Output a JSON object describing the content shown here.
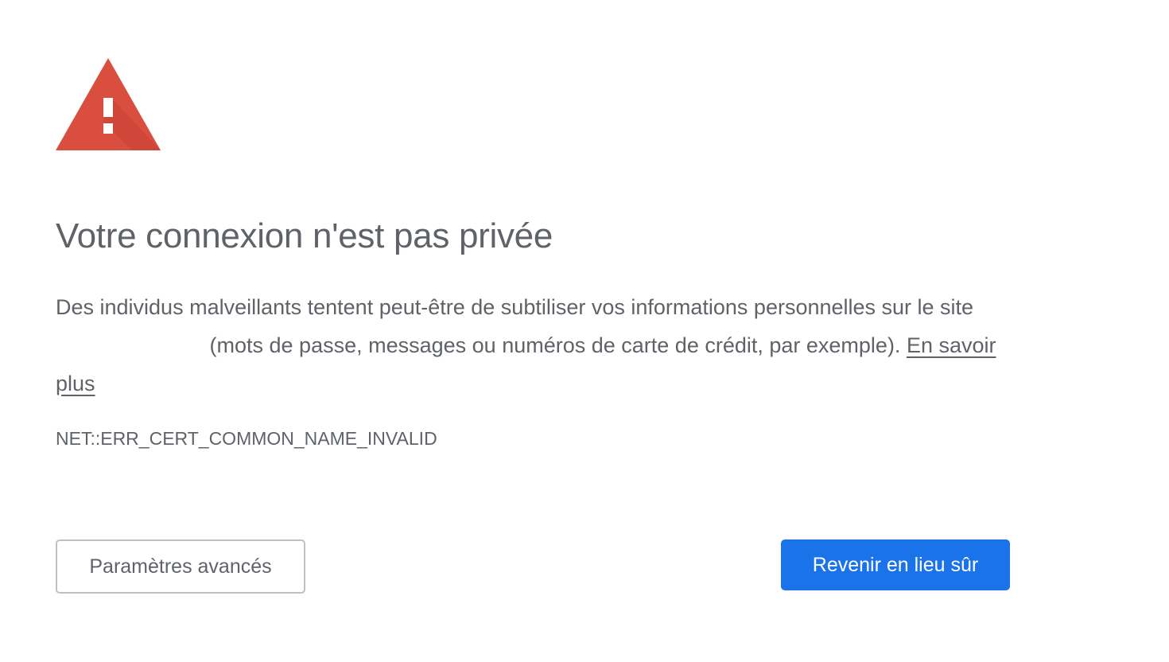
{
  "icon": {
    "name": "warning-triangle-icon",
    "color": "#d94e3f",
    "shadow_color": "#c0392b"
  },
  "interstitial": {
    "title": "Votre connexion n'est pas privée",
    "message_part1": "Des individus malveillants tentent peut-être de subtiliser vos informations personnelles sur le site",
    "message_part2": "(mots de passe, messages ou numéros de carte de crédit, par exemple).",
    "learn_more": "En savoir plus",
    "error_code": "NET::ERR_CERT_COMMON_NAME_INVALID"
  },
  "buttons": {
    "advanced": "Paramètres avancés",
    "back_to_safety": "Revenir en lieu sûr"
  },
  "colors": {
    "text": "#5f6368",
    "primary_button": "#1a73e8",
    "secondary_border": "#bdc1c6"
  }
}
